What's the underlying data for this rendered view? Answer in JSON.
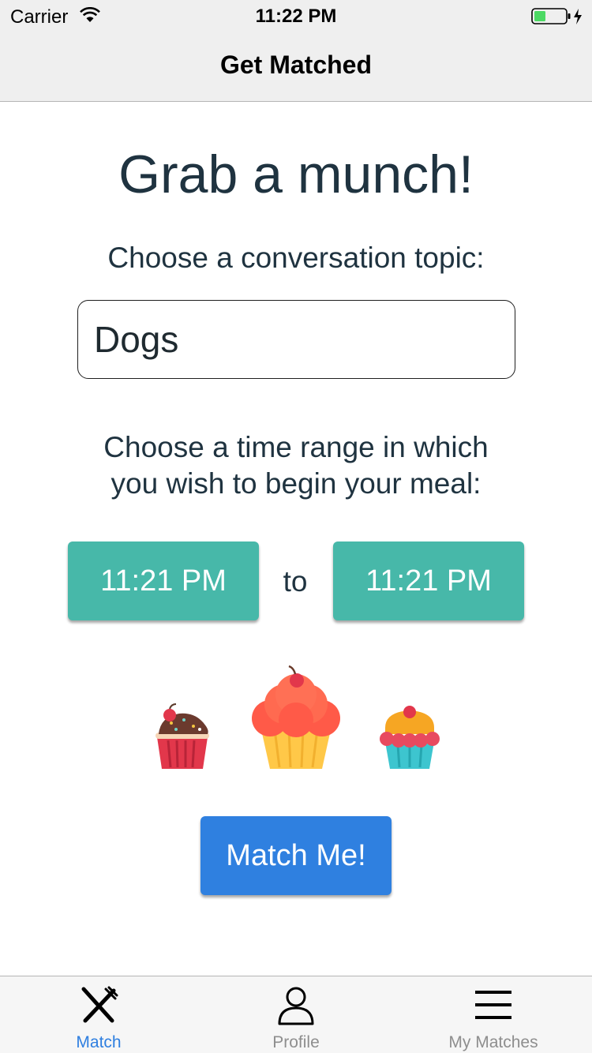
{
  "status_bar": {
    "carrier": "Carrier",
    "time": "11:22 PM",
    "battery_color": "#4cd964"
  },
  "nav": {
    "title": "Get Matched"
  },
  "main": {
    "headline": "Grab a munch!",
    "topic_prompt": "Choose a conversation topic:",
    "topic_value": "Dogs",
    "time_prompt_line1": "Choose a time range in which",
    "time_prompt_line2": "you wish to begin your meal:",
    "start_time": "11:21 PM",
    "to_label": "to",
    "end_time": "11:21 PM",
    "match_button": "Match Me!",
    "time_button_color": "#47b8a9",
    "match_button_color": "#2f80e0"
  },
  "tabs": [
    {
      "label": "Match",
      "icon": "fork-knife-icon",
      "active": true
    },
    {
      "label": "Profile",
      "icon": "person-icon",
      "active": false
    },
    {
      "label": "My Matches",
      "icon": "menu-icon",
      "active": false
    }
  ],
  "accent_color": "#2f7fe0"
}
